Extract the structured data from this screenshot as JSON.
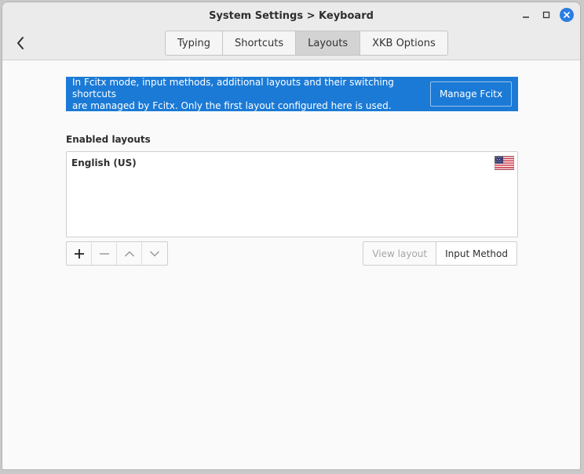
{
  "window": {
    "title": "System Settings > Keyboard"
  },
  "header": {
    "back_icon": "chevron-left-icon",
    "window_controls": [
      "minimize-icon",
      "maximize-icon",
      "close-icon"
    ]
  },
  "tabs": [
    {
      "label": "Typing",
      "active": false
    },
    {
      "label": "Shortcuts",
      "active": false
    },
    {
      "label": "Layouts",
      "active": true
    },
    {
      "label": "XKB Options",
      "active": false
    }
  ],
  "banner": {
    "text_line1": "In Fcitx mode, input methods, additional layouts and their switching shortcuts",
    "text_line2": "are managed by Fcitx. Only the first layout configured here is used.",
    "button_label": "Manage Fcitx",
    "color": "#1b7ad6"
  },
  "layouts": {
    "section_label": "Enabled layouts",
    "items": [
      {
        "name": "English (US)",
        "flag_icon": "us-flag-icon"
      }
    ]
  },
  "list_tools": [
    "add-icon",
    "remove-icon",
    "move-up-icon",
    "move-down-icon"
  ],
  "actions": {
    "view_layout_label": "View layout",
    "input_method_label": "Input Method"
  }
}
